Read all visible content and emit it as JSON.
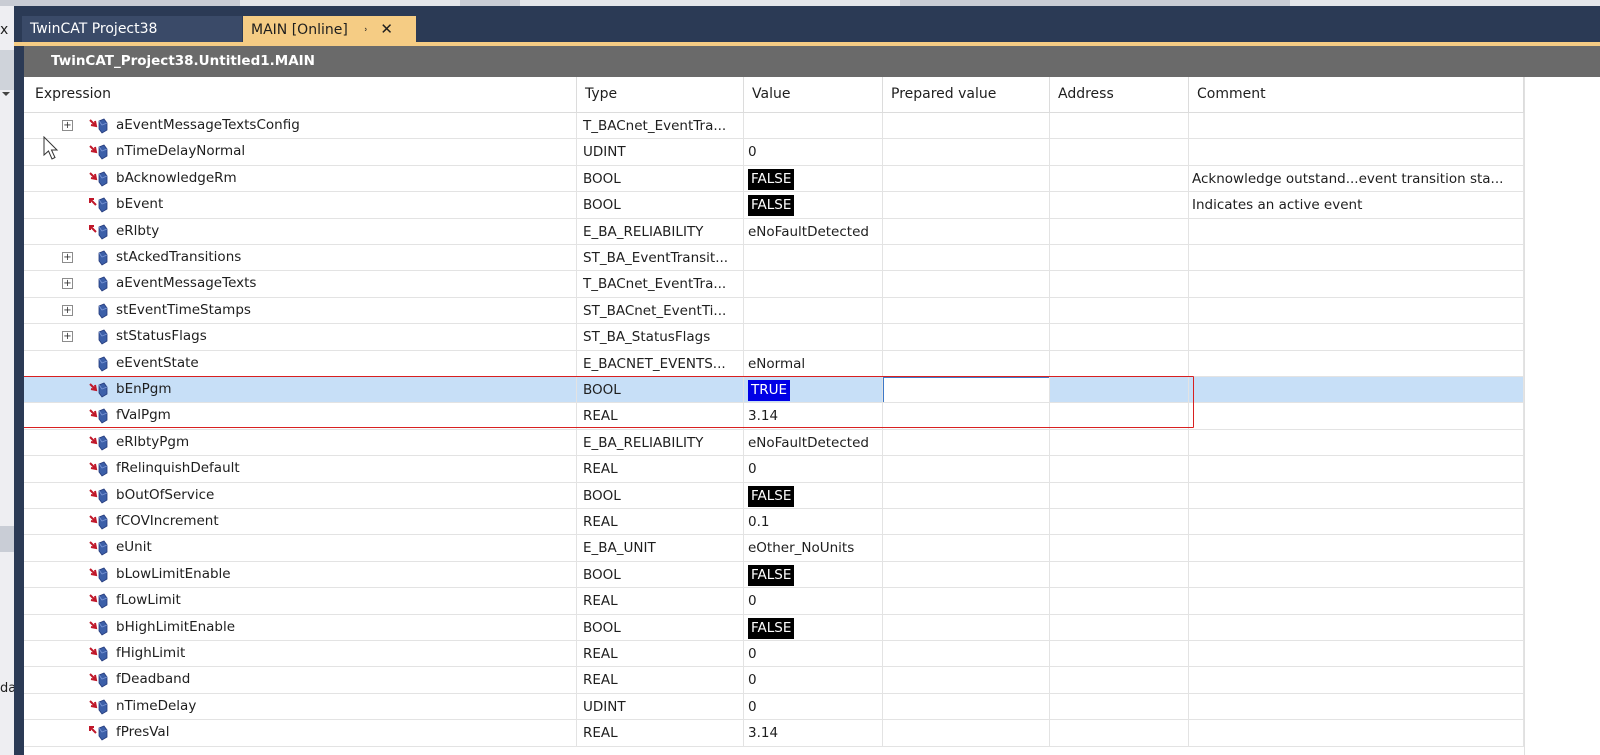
{
  "window": {
    "tabs": [
      {
        "label": "TwinCAT Project38",
        "active": false
      },
      {
        "label": "MAIN [Online]",
        "active": true,
        "pin_icon": "pin-icon",
        "close_icon": "close-icon"
      }
    ],
    "left_panel": {
      "close_glyph": "x",
      "partial_text": "da"
    }
  },
  "document": {
    "title": "TwinCAT_Project38.Untitled1.MAIN",
    "columns": {
      "expression": "Expression",
      "type": "Type",
      "value": "Value",
      "prepared": "Prepared value",
      "address": "Address",
      "comment": "Comment"
    },
    "rows": [
      {
        "name": "aEventMessageTextsConfig",
        "type": "T_BACnet_EventTra...",
        "value": "",
        "comment": "",
        "expandable": true,
        "icon": "output-variable-icon"
      },
      {
        "name": "nTimeDelayNormal",
        "type": "UDINT",
        "value": "0",
        "comment": "",
        "expandable": false,
        "icon": "output-variable-icon"
      },
      {
        "name": "bAcknowledgeRm",
        "type": "BOOL",
        "value": "FALSE",
        "comment": "Acknowledge outstand...event transition sta...",
        "expandable": false,
        "icon": "output-variable-icon"
      },
      {
        "name": "bEvent",
        "type": "BOOL",
        "value": "FALSE",
        "comment": "Indicates an active event",
        "expandable": false,
        "icon": "input-variable-icon"
      },
      {
        "name": "eRlbty",
        "type": "E_BA_RELIABILITY",
        "value": "eNoFaultDetected",
        "comment": "",
        "expandable": false,
        "icon": "input-variable-icon"
      },
      {
        "name": "stAckedTransitions",
        "type": "ST_BA_EventTransit...",
        "value": "",
        "comment": "",
        "expandable": true,
        "icon": "local-variable-icon"
      },
      {
        "name": "aEventMessageTexts",
        "type": "T_BACnet_EventTra...",
        "value": "",
        "comment": "",
        "expandable": true,
        "icon": "local-variable-icon"
      },
      {
        "name": "stEventTimeStamps",
        "type": "ST_BACnet_EventTi...",
        "value": "",
        "comment": "",
        "expandable": true,
        "icon": "local-variable-icon"
      },
      {
        "name": "stStatusFlags",
        "type": "ST_BA_StatusFlags",
        "value": "",
        "comment": "",
        "expandable": true,
        "icon": "local-variable-icon"
      },
      {
        "name": "eEventState",
        "type": "E_BACNET_EVENTS...",
        "value": "eNormal",
        "comment": "",
        "expandable": false,
        "icon": "local-variable-icon"
      },
      {
        "name": "bEnPgm",
        "type": "BOOL",
        "value": "TRUE",
        "comment": "",
        "expandable": false,
        "icon": "output-variable-icon",
        "selected": true
      },
      {
        "name": "fValPgm",
        "type": "REAL",
        "value": "3.14",
        "comment": "",
        "expandable": false,
        "icon": "output-variable-icon"
      },
      {
        "name": "eRlbtyPgm",
        "type": "E_BA_RELIABILITY",
        "value": "eNoFaultDetected",
        "comment": "",
        "expandable": false,
        "icon": "output-variable-icon"
      },
      {
        "name": "fRelinquishDefault",
        "type": "REAL",
        "value": "0",
        "comment": "",
        "expandable": false,
        "icon": "output-variable-icon"
      },
      {
        "name": "bOutOfService",
        "type": "BOOL",
        "value": "FALSE",
        "comment": "",
        "expandable": false,
        "icon": "output-variable-icon"
      },
      {
        "name": "fCOVIncrement",
        "type": "REAL",
        "value": "0.1",
        "comment": "",
        "expandable": false,
        "icon": "output-variable-icon"
      },
      {
        "name": "eUnit",
        "type": "E_BA_UNIT",
        "value": "eOther_NoUnits",
        "comment": "",
        "expandable": false,
        "icon": "output-variable-icon"
      },
      {
        "name": "bLowLimitEnable",
        "type": "BOOL",
        "value": "FALSE",
        "comment": "",
        "expandable": false,
        "icon": "output-variable-icon"
      },
      {
        "name": "fLowLimit",
        "type": "REAL",
        "value": "0",
        "comment": "",
        "expandable": false,
        "icon": "output-variable-icon"
      },
      {
        "name": "bHighLimitEnable",
        "type": "BOOL",
        "value": "FALSE",
        "comment": "",
        "expandable": false,
        "icon": "output-variable-icon"
      },
      {
        "name": "fHighLimit",
        "type": "REAL",
        "value": "0",
        "comment": "",
        "expandable": false,
        "icon": "output-variable-icon"
      },
      {
        "name": "fDeadband",
        "type": "REAL",
        "value": "0",
        "comment": "",
        "expandable": false,
        "icon": "output-variable-icon"
      },
      {
        "name": "nTimeDelay",
        "type": "UDINT",
        "value": "0",
        "comment": "",
        "expandable": false,
        "icon": "output-variable-icon"
      },
      {
        "name": "fPresVal",
        "type": "REAL",
        "value": "3.14",
        "comment": "",
        "expandable": false,
        "icon": "input-variable-icon"
      }
    ]
  },
  "colors": {
    "accent_tab": "#f5cc84",
    "selected_row": "#c7dff7",
    "false_badge": "#000000",
    "true_badge": "#0000e6",
    "highlight_box": "#d82020"
  }
}
